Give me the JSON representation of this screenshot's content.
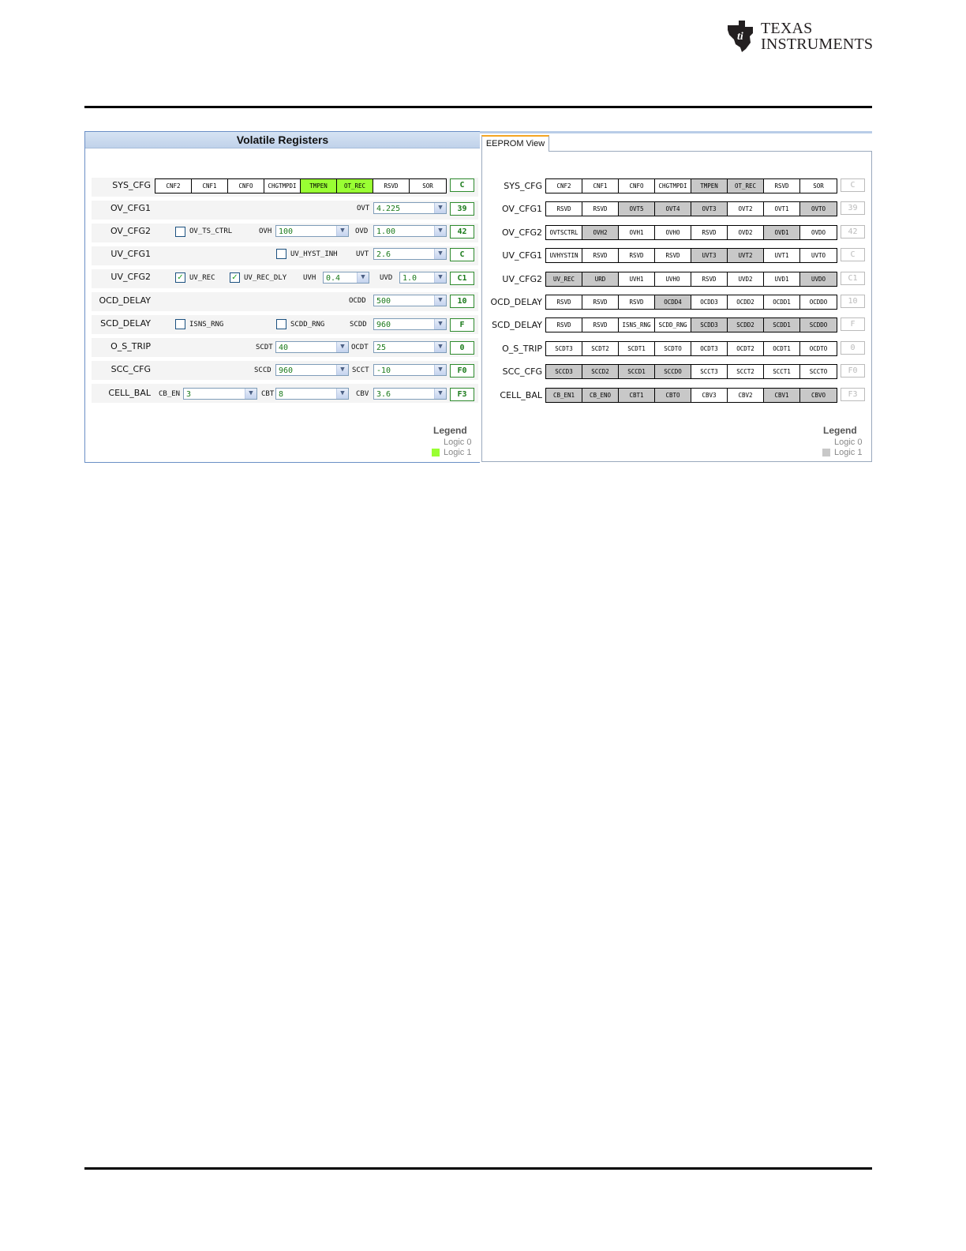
{
  "header": {
    "logo_text_line1": "Texas",
    "logo_text_line2": "Instruments"
  },
  "volatile": {
    "title": "Volatile Registers",
    "legend": {
      "title": "Legend",
      "logic0": "Logic 0",
      "logic1": "Logic 1",
      "logic1_color": "#99ff33"
    },
    "sys_cfg": {
      "label": "SYS_CFG",
      "bits": [
        {
          "name": "CNF2",
          "on": false
        },
        {
          "name": "CNF1",
          "on": false
        },
        {
          "name": "CNFO",
          "on": false
        },
        {
          "name": "CHGTMPDI",
          "on": false
        },
        {
          "name": "TMPEN",
          "on": true
        },
        {
          "name": "OT_REC",
          "on": true
        },
        {
          "name": "RSVD",
          "on": false
        },
        {
          "name": "SOR",
          "on": false
        }
      ],
      "hex": "C"
    },
    "ov_cfg1": {
      "label": "OV_CFG1",
      "ovt_label": "OVT",
      "ovt_value": "4.225",
      "hex": "39"
    },
    "ov_cfg2": {
      "label": "OV_CFG2",
      "cb_label": "OV_TS_CTRL",
      "cb_checked": false,
      "ovh_label": "OVH",
      "ovh_value": "100",
      "ovd_label": "OVD",
      "ovd_value": "1.00",
      "hex": "42"
    },
    "uv_cfg1": {
      "label": "UV_CFG1",
      "cb_label": "UV_HYST_INH",
      "cb_checked": false,
      "uvt_label": "UVT",
      "uvt_value": "2.6",
      "hex": "C"
    },
    "uv_cfg2": {
      "label": "UV_CFG2",
      "cb1_label": "UV_REC",
      "cb1_checked": true,
      "cb2_label": "UV_REC_DLY",
      "cb2_checked": true,
      "uvh_label": "UVH",
      "uvh_value": "0.4",
      "uvd_label": "UVD",
      "uvd_value": "1.0",
      "hex": "C1"
    },
    "ocd_delay": {
      "label": "OCD_DELAY",
      "ocdd_label": "OCDD",
      "ocdd_value": "500",
      "hex": "10"
    },
    "scd_delay": {
      "label": "SCD_DELAY",
      "cb1_label": "ISNS_RNG",
      "cb1_checked": false,
      "cb2_label": "SCDD_RNG",
      "cb2_checked": false,
      "scdd_label": "SCDD",
      "scdd_value": "960",
      "hex": "F"
    },
    "o_s_trip": {
      "label": "O_S_TRIP",
      "scdt_label": "SCDT",
      "scdt_value": "40",
      "ocdt_label": "OCDT",
      "ocdt_value": "25",
      "hex": "0"
    },
    "scc_cfg": {
      "label": "SCC_CFG",
      "sccd_label": "SCCD",
      "sccd_value": "960",
      "scct_label": "SCCT",
      "scct_value": "-10",
      "hex": "F0"
    },
    "cell_bal": {
      "label": "CELL_BAL",
      "cb_en_label": "CB_EN",
      "cb_en_value": "3",
      "cbt_label": "CBT",
      "cbt_value": "8",
      "cbv_label": "CBV",
      "cbv_value": "3.6",
      "hex": "F3"
    }
  },
  "eeprom": {
    "tab_label": "EEPROM View",
    "legend": {
      "title": "Legend",
      "logic0": "Logic 0",
      "logic1": "Logic 1",
      "logic1_color": "#c8c8c8"
    },
    "registers": [
      {
        "label": "SYS_CFG",
        "hex": "C",
        "bits": [
          [
            "CNF2",
            0
          ],
          [
            "CNF1",
            0
          ],
          [
            "CNFO",
            0
          ],
          [
            "CHGTMPDI",
            0
          ],
          [
            "TMPEN",
            1
          ],
          [
            "OT_REC",
            1
          ],
          [
            "RSVD",
            0
          ],
          [
            "SOR",
            0
          ]
        ]
      },
      {
        "label": "OV_CFG1",
        "hex": "39",
        "bits": [
          [
            "RSVD",
            0
          ],
          [
            "RSVD",
            0
          ],
          [
            "OVT5",
            1
          ],
          [
            "OVT4",
            1
          ],
          [
            "OVT3",
            1
          ],
          [
            "OVT2",
            0
          ],
          [
            "OVT1",
            0
          ],
          [
            "OVTO",
            1
          ]
        ]
      },
      {
        "label": "OV_CFG2",
        "hex": "42",
        "bits": [
          [
            "OVTSCTRL",
            0
          ],
          [
            "OVH2",
            1
          ],
          [
            "OVH1",
            0
          ],
          [
            "OVHO",
            0
          ],
          [
            "RSVD",
            0
          ],
          [
            "OVD2",
            0
          ],
          [
            "OVD1",
            1
          ],
          [
            "OVDO",
            0
          ]
        ]
      },
      {
        "label": "UV_CFG1",
        "hex": "C",
        "bits": [
          [
            "UVHYSTIN",
            0
          ],
          [
            "RSVD",
            0
          ],
          [
            "RSVD",
            0
          ],
          [
            "RSVD",
            0
          ],
          [
            "UVT3",
            1
          ],
          [
            "UVT2",
            1
          ],
          [
            "UVT1",
            0
          ],
          [
            "UVTO",
            0
          ]
        ]
      },
      {
        "label": "UV_CFG2",
        "hex": "C1",
        "bits": [
          [
            "UV_REC",
            1
          ],
          [
            "URD",
            1
          ],
          [
            "UVH1",
            0
          ],
          [
            "UVHO",
            0
          ],
          [
            "RSVD",
            0
          ],
          [
            "UVD2",
            0
          ],
          [
            "UVD1",
            0
          ],
          [
            "UVDO",
            1
          ]
        ]
      },
      {
        "label": "OCD_DELAY",
        "hex": "10",
        "bits": [
          [
            "RSVD",
            0
          ],
          [
            "RSVD",
            0
          ],
          [
            "RSVD",
            0
          ],
          [
            "OCDD4",
            1
          ],
          [
            "OCDD3",
            0
          ],
          [
            "OCDD2",
            0
          ],
          [
            "OCDD1",
            0
          ],
          [
            "OCDDO",
            0
          ]
        ]
      },
      {
        "label": "SCD_DELAY",
        "hex": "F",
        "bits": [
          [
            "RSVD",
            0
          ],
          [
            "RSVD",
            0
          ],
          [
            "ISNS_RNG",
            0
          ],
          [
            "SCDD_RNG",
            0
          ],
          [
            "SCDD3",
            1
          ],
          [
            "SCDD2",
            1
          ],
          [
            "SCDD1",
            1
          ],
          [
            "SCDDO",
            1
          ]
        ]
      },
      {
        "label": "O_S_TRIP",
        "hex": "0",
        "bits": [
          [
            "SCDT3",
            0
          ],
          [
            "SCDT2",
            0
          ],
          [
            "SCDT1",
            0
          ],
          [
            "SCDTO",
            0
          ],
          [
            "OCDT3",
            0
          ],
          [
            "OCDT2",
            0
          ],
          [
            "OCDT1",
            0
          ],
          [
            "OCDTO",
            0
          ]
        ]
      },
      {
        "label": "SCC_CFG",
        "hex": "F0",
        "bits": [
          [
            "SCCD3",
            1
          ],
          [
            "SCCD2",
            1
          ],
          [
            "SCCD1",
            1
          ],
          [
            "SCCDO",
            1
          ],
          [
            "SCCT3",
            0
          ],
          [
            "SCCT2",
            0
          ],
          [
            "SCCT1",
            0
          ],
          [
            "SCCTO",
            0
          ]
        ]
      },
      {
        "label": "CELL_BAL",
        "hex": "F3",
        "bits": [
          [
            "CB_EN1",
            1
          ],
          [
            "CB_ENO",
            1
          ],
          [
            "CBT1",
            1
          ],
          [
            "CBTO",
            1
          ],
          [
            "CBV3",
            0
          ],
          [
            "CBV2",
            0
          ],
          [
            "CBV1",
            1
          ],
          [
            "CBVO",
            1
          ]
        ]
      }
    ]
  }
}
